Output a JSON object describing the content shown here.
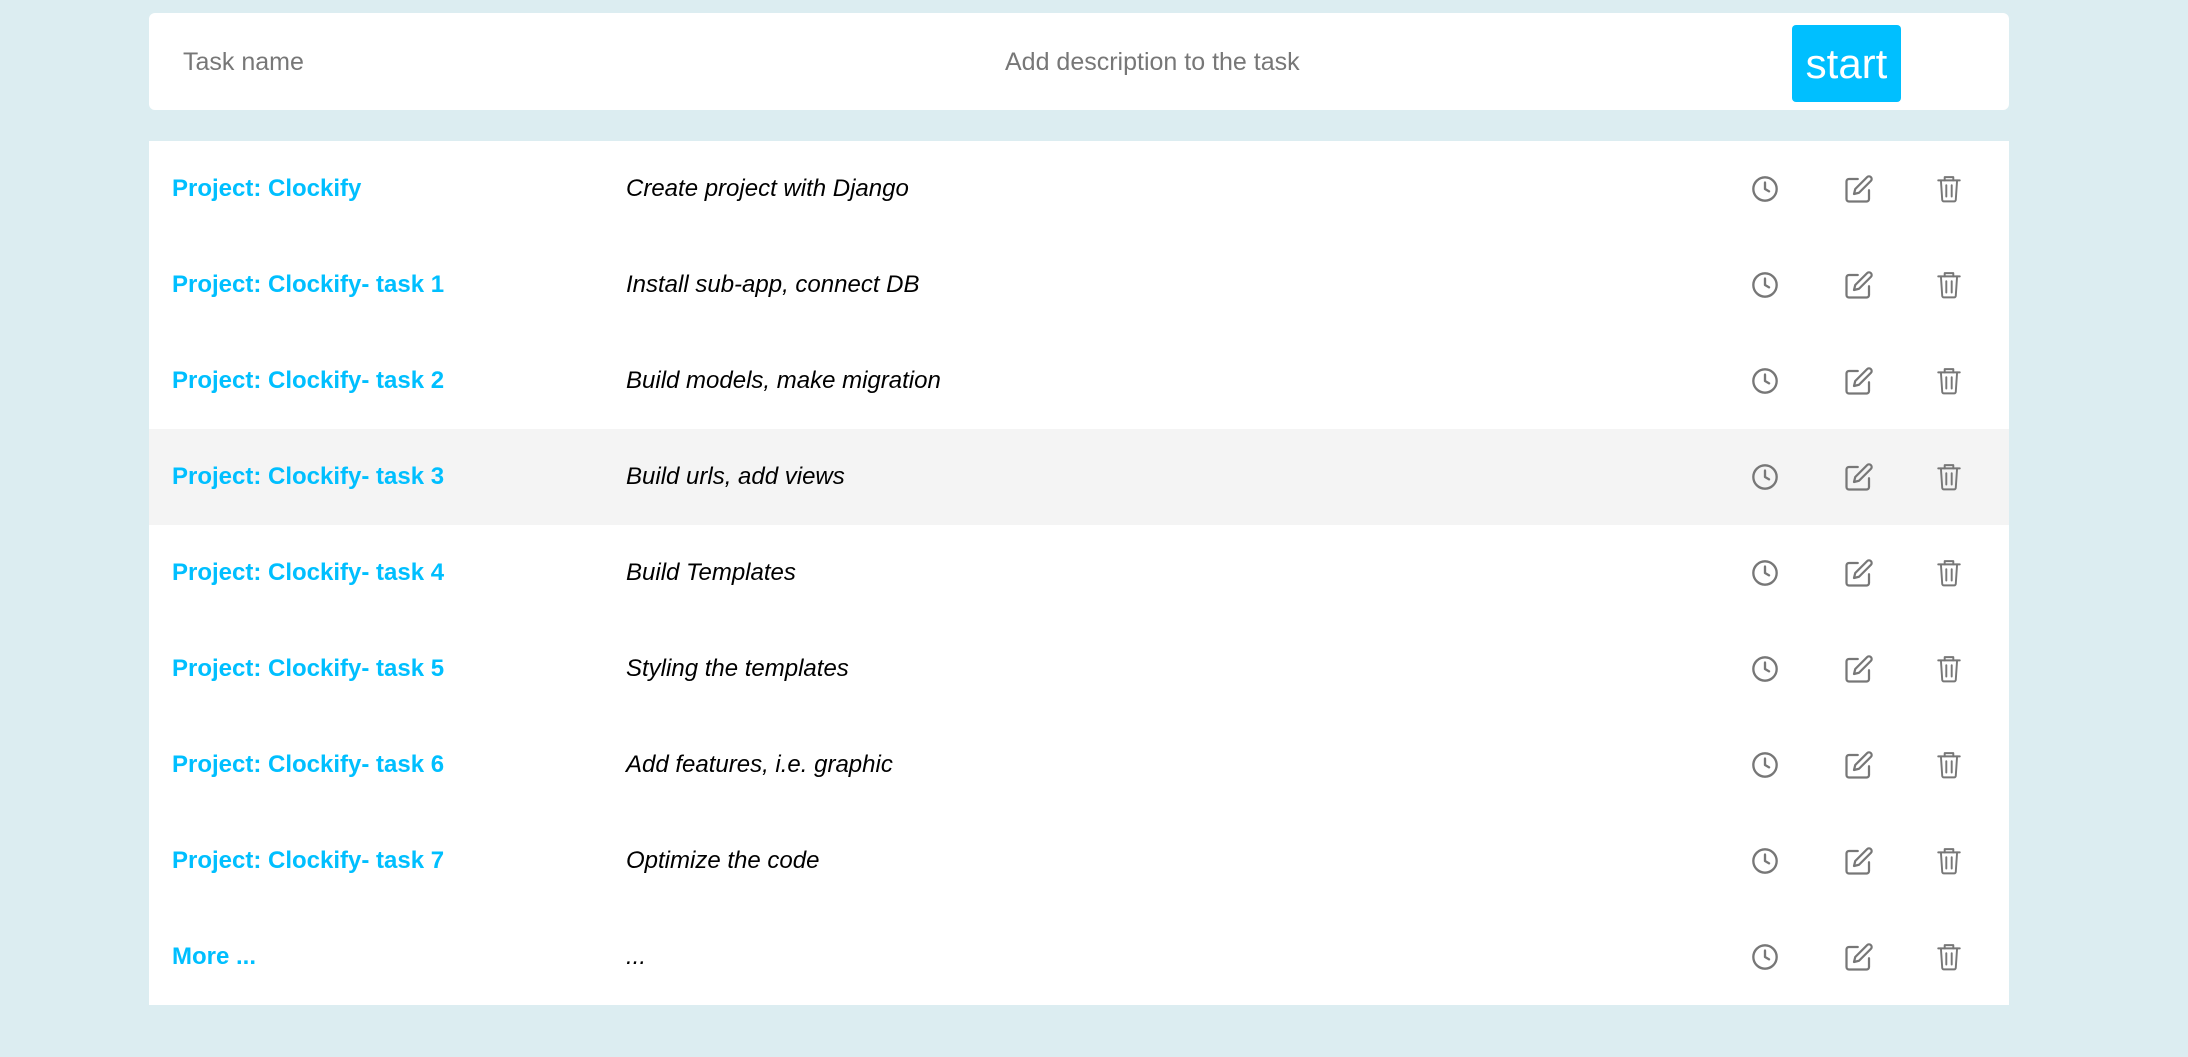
{
  "form": {
    "task_name_placeholder": "Task name",
    "description_placeholder": "Add description to the task",
    "start_label": "start"
  },
  "colors": {
    "accent": "#00bfff",
    "background": "#dcedf1",
    "row_highlight": "#f4f4f4",
    "icon": "#777777"
  },
  "tasks": [
    {
      "project": "Project: Clockify",
      "description": "Create project with Django"
    },
    {
      "project": "Project: Clockify- task 1",
      "description": "Install sub-app, connect DB"
    },
    {
      "project": "Project: Clockify- task 2",
      "description": "Build models, make migration"
    },
    {
      "project": "Project: Clockify- task 3",
      "description": "Build urls, add views",
      "highlighted": true
    },
    {
      "project": "Project: Clockify- task 4",
      "description": "Build Templates"
    },
    {
      "project": "Project: Clockify- task 5",
      "description": "Styling the templates"
    },
    {
      "project": "Project: Clockify- task 6",
      "description": "Add features, i.e. graphic"
    },
    {
      "project": "Project: Clockify- task 7",
      "description": "Optimize the code"
    },
    {
      "project": "More ...",
      "description": "..."
    }
  ],
  "row_icons": [
    "clock-icon",
    "edit-icon",
    "trash-icon"
  ]
}
